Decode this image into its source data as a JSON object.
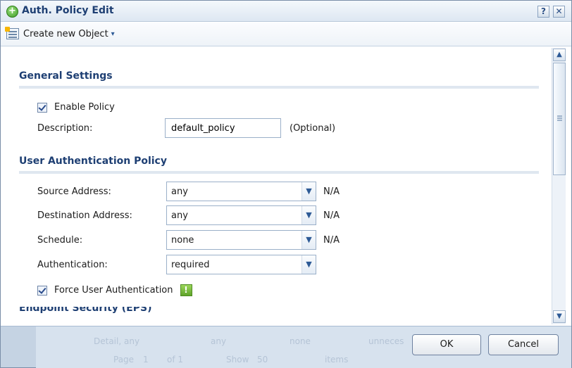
{
  "window": {
    "title": "Auth. Policy Edit",
    "help_label": "?",
    "close_label": "✕"
  },
  "toolbar": {
    "create_label": "Create new Object",
    "caret": "▾"
  },
  "general": {
    "header": "General Settings",
    "enable_label": "Enable Policy",
    "enable_checked": true,
    "description_label": "Description:",
    "description_value": "default_policy",
    "optional_label": "(Optional)"
  },
  "auth_policy": {
    "header": "User Authentication Policy",
    "source_label": "Source Address:",
    "source_value": "any",
    "source_na": "N/A",
    "dest_label": "Destination Address:",
    "dest_value": "any",
    "dest_na": "N/A",
    "schedule_label": "Schedule:",
    "schedule_value": "none",
    "schedule_na": "N/A",
    "authentication_label": "Authentication:",
    "authentication_value": "required",
    "force_label": "Force User Authentication",
    "force_checked": true,
    "warn_glyph": "!"
  },
  "next_section_partial": "Endpoint Security (EPS)",
  "footer": {
    "ok_label": "OK",
    "cancel_label": "Cancel",
    "ghost_row1": [
      "Detail, any",
      "any",
      "none",
      "unneces"
    ],
    "ghost_row2": [
      "Page",
      "1",
      "of 1",
      "Show",
      "50",
      "items"
    ]
  },
  "icons": {
    "arrow_down": "▼",
    "arrow_up": "▲",
    "title": "add-circle-icon",
    "warning": "warning-icon"
  },
  "colors": {
    "title_text": "#1e3f73",
    "section_rule": "#dfe7f0",
    "footer_bg": "#c5d3e3"
  }
}
